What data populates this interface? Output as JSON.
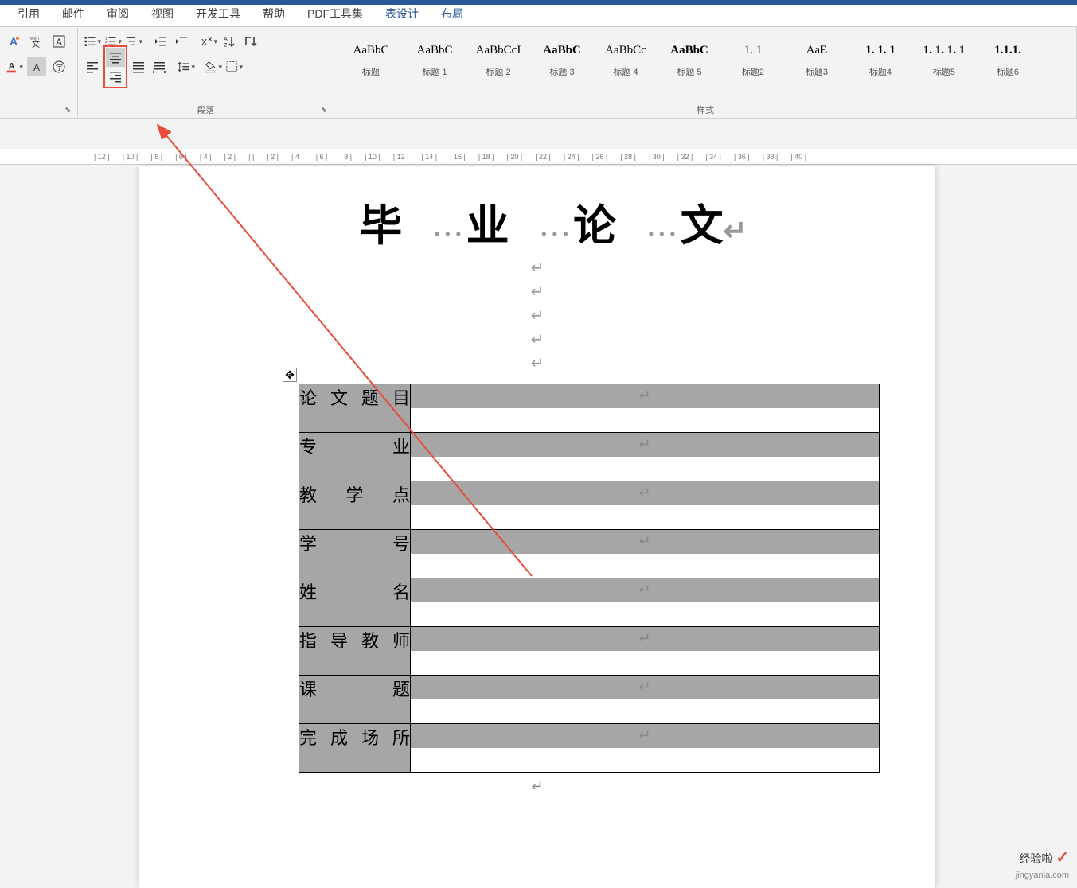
{
  "tabs": [
    "引用",
    "邮件",
    "审阅",
    "视图",
    "开发工具",
    "帮助",
    "PDF工具集",
    "表设计",
    "布局"
  ],
  "active_contextual_tabs": [
    "表设计",
    "布局"
  ],
  "ribbon": {
    "paragraph_group_label": "段落",
    "styles_group_label": "样式"
  },
  "styles": [
    {
      "preview": "AaBbC",
      "name": "标题",
      "bold": false
    },
    {
      "preview": "AaBbC",
      "name": "标题 1",
      "bold": false
    },
    {
      "preview": "AaBbCcI",
      "name": "标题 2",
      "bold": false
    },
    {
      "preview": "AaBbC",
      "name": "标题 3",
      "bold": true
    },
    {
      "preview": "AaBbCc",
      "name": "标题 4",
      "bold": false
    },
    {
      "preview": "AaBbC",
      "name": "标题 5",
      "bold": true
    },
    {
      "preview": "1. 1",
      "name": "标题2",
      "bold": false
    },
    {
      "preview": "AaE",
      "name": "标题3",
      "bold": false
    },
    {
      "preview": "1. 1. 1",
      "name": "标题4",
      "bold": true
    },
    {
      "preview": "1. 1. 1. 1",
      "name": "标题5",
      "bold": true
    },
    {
      "preview": "1.1.1.",
      "name": "标题6",
      "bold": true
    }
  ],
  "document": {
    "title": "毕 业 论 文",
    "title_with_dots": "毕···业···论···文",
    "pm": "↵"
  },
  "table": {
    "rows": [
      {
        "label": "论文题目",
        "value": ""
      },
      {
        "label": "专　　业",
        "value": ""
      },
      {
        "label": "教 学 点",
        "value": ""
      },
      {
        "label": "学　　号",
        "value": ""
      },
      {
        "label": "姓　　名",
        "value": ""
      },
      {
        "label": "指导教师",
        "value": ""
      },
      {
        "label": "课　　题",
        "value": ""
      },
      {
        "label": "完成场所",
        "value": ""
      }
    ]
  },
  "ruler_marks": [
    "12",
    "10",
    "8",
    "6",
    "4",
    "2",
    "",
    "2",
    "4",
    "6",
    "8",
    "10",
    "12",
    "14",
    "16",
    "18",
    "20",
    "22",
    "24",
    "26",
    "28",
    "30",
    "32",
    "34",
    "36",
    "38",
    "40"
  ],
  "watermark": {
    "text": "经验啦",
    "url": "jingyanla.com"
  },
  "icons": {
    "font_effects": "A◇",
    "font_pinyin": "wén文",
    "font_border": "A",
    "font_color": "A",
    "font_highlight": "A",
    "font_circle": "字"
  }
}
